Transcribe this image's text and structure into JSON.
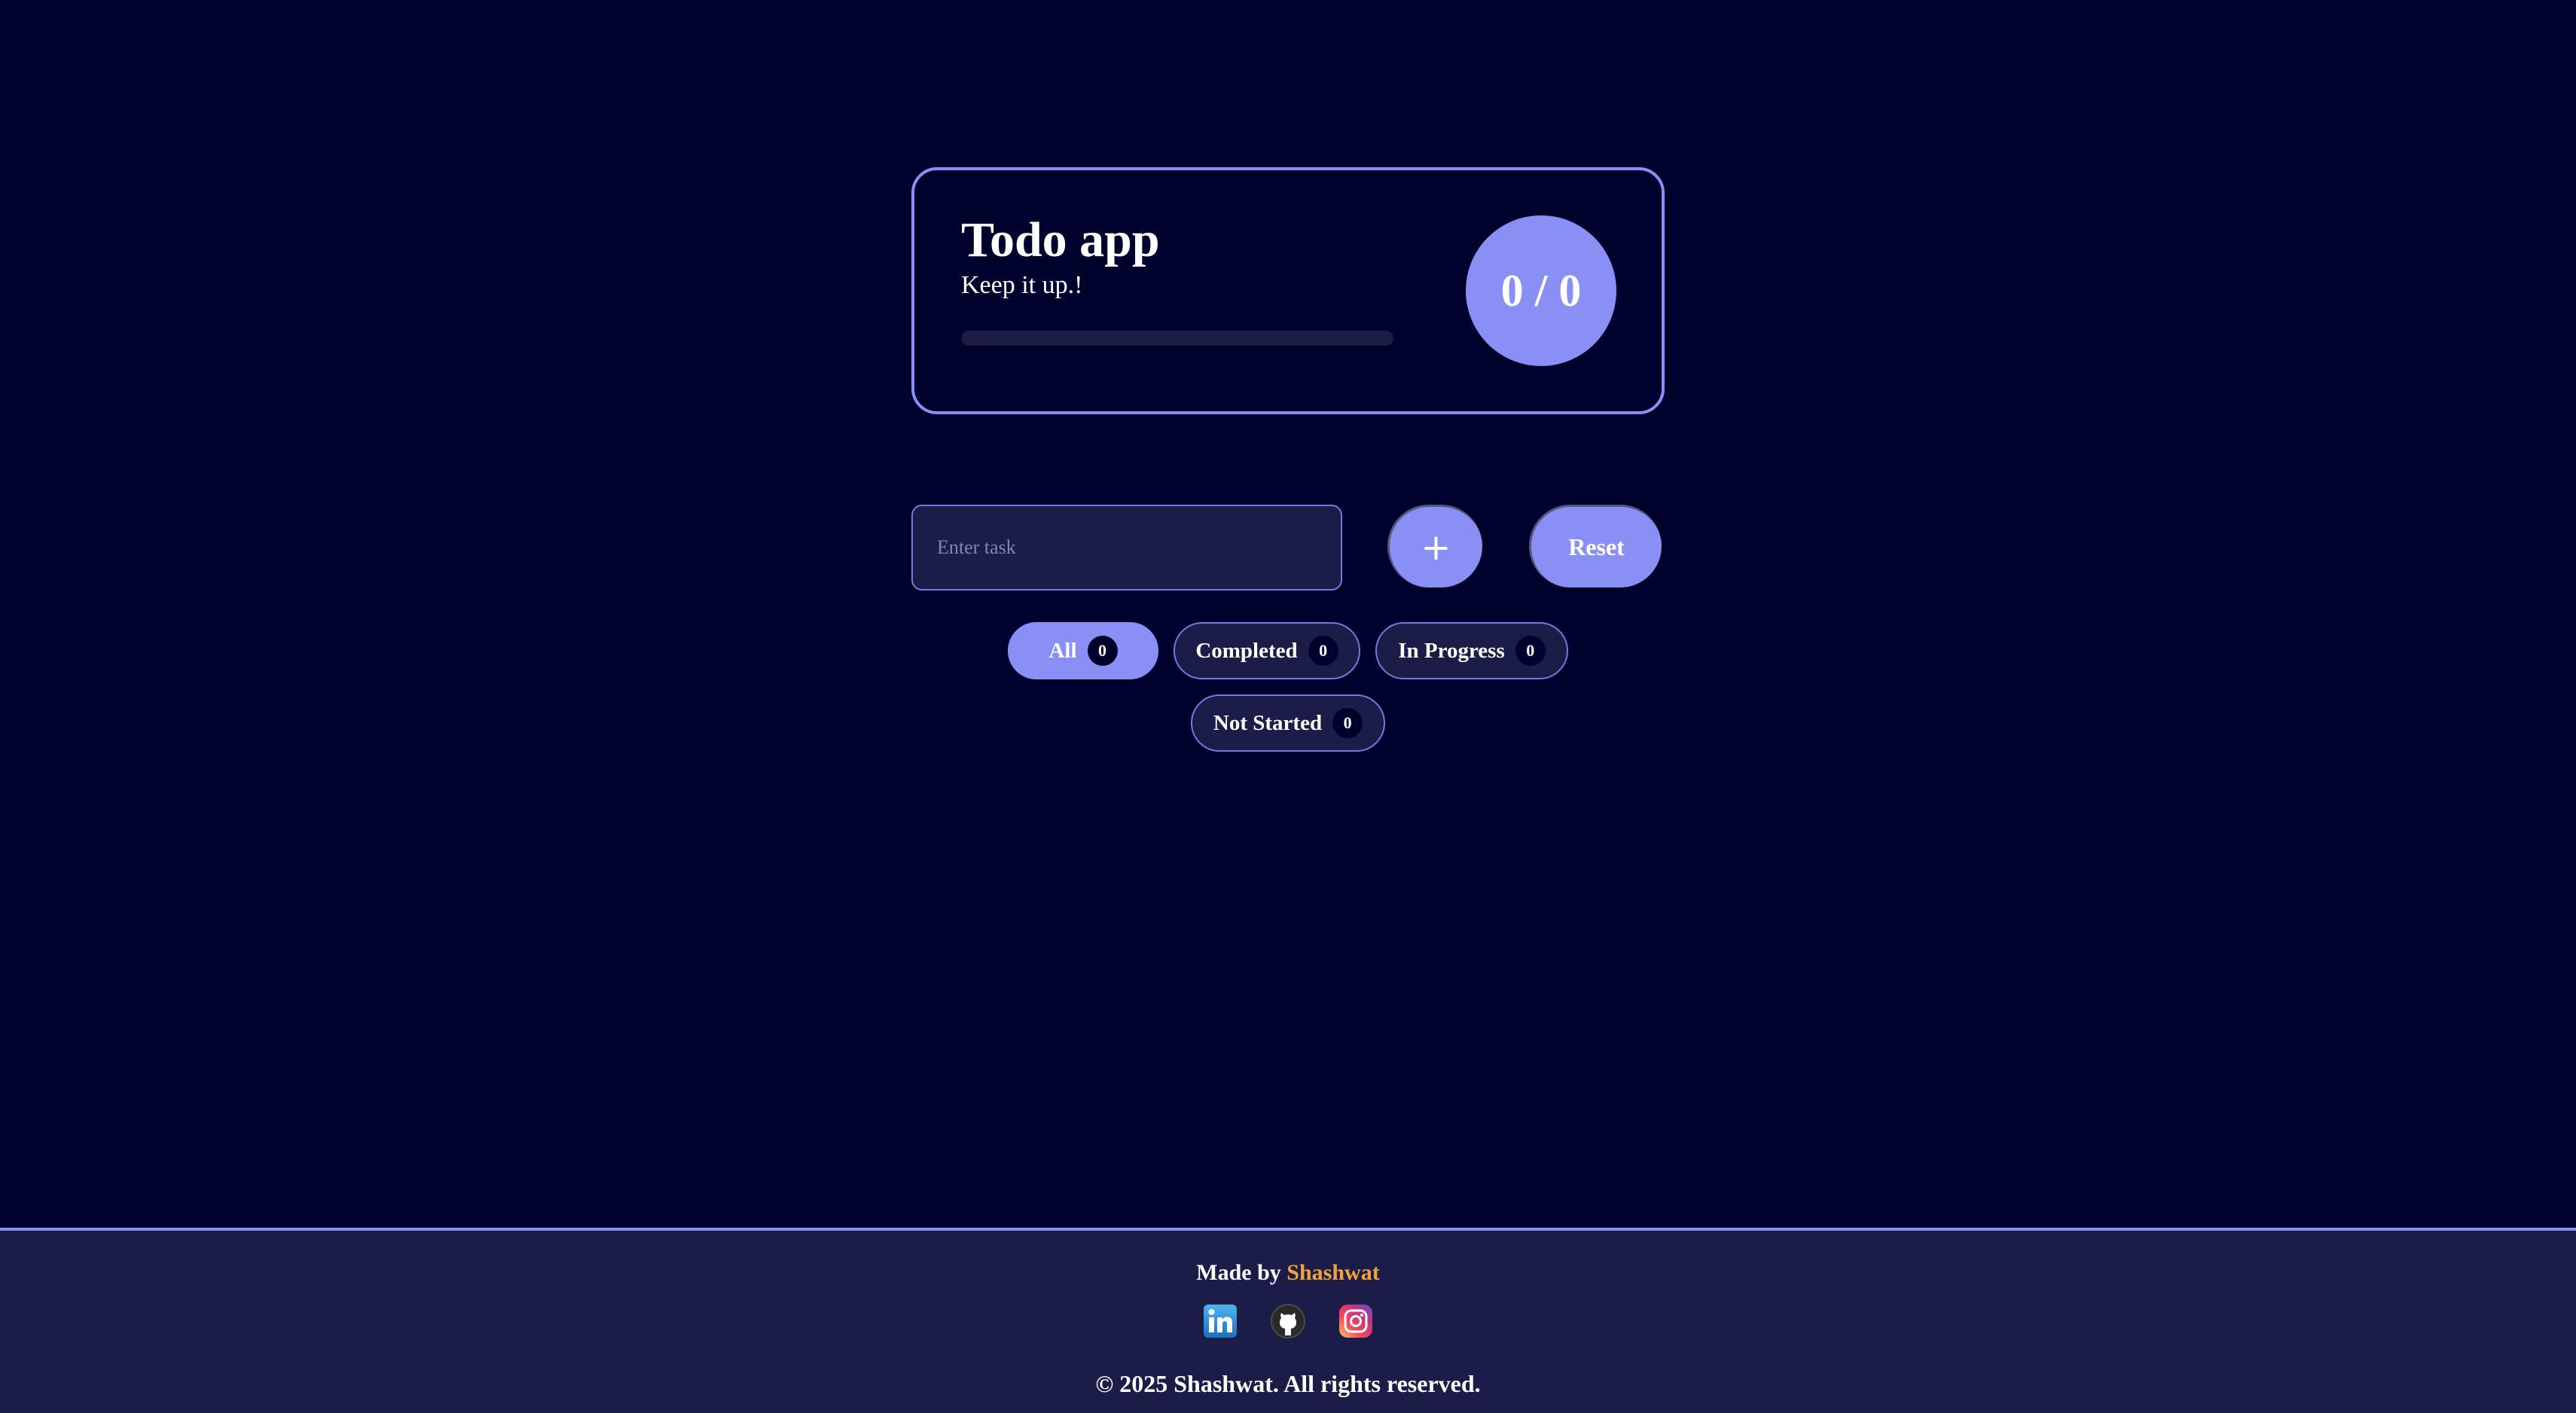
{
  "header_card": {
    "title": "Todo app",
    "subtitle": "Keep it up.!",
    "progress_fraction": 0,
    "counter": "0 / 0"
  },
  "task_form": {
    "input_value": "",
    "input_placeholder": "Enter task",
    "add_label": "+",
    "reset_label": "Reset"
  },
  "filters": [
    {
      "label": "All",
      "count": "0",
      "active": true
    },
    {
      "label": "Completed",
      "count": "0",
      "active": false
    },
    {
      "label": "In Progress",
      "count": "0",
      "active": false
    },
    {
      "label": "Not Started",
      "count": "0",
      "active": false
    }
  ],
  "footer": {
    "made_by_prefix": "Made by",
    "author": "Shashwat",
    "social_icons": [
      "linkedin-icon",
      "github-icon",
      "instagram-icon"
    ],
    "copyright": "© 2025 Shashwat. All rights reserved."
  },
  "colors": {
    "background": "#00022e",
    "accent": "#8a8ff5",
    "panel": "#1b1c47",
    "author_highlight": "#f5a13b"
  }
}
